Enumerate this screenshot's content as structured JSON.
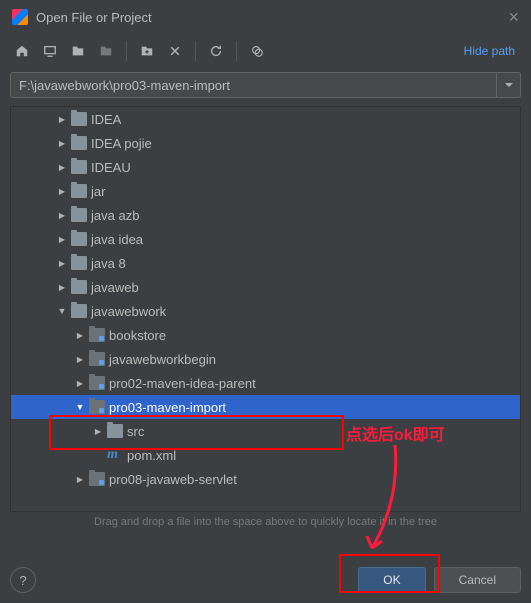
{
  "window": {
    "title": "Open File or Project",
    "hide_path": "Hide path",
    "path": "F:\\javawebwork\\pro03-maven-import",
    "hint": "Drag and drop a file into the space above to quickly locate it in the tree",
    "ok": "OK",
    "cancel": "Cancel"
  },
  "tree": [
    {
      "depth": 2,
      "arrow": "right",
      "icon": "folder",
      "label": "IDEA"
    },
    {
      "depth": 2,
      "arrow": "right",
      "icon": "folder",
      "label": "IDEA pojie"
    },
    {
      "depth": 2,
      "arrow": "right",
      "icon": "folder",
      "label": "IDEAU"
    },
    {
      "depth": 2,
      "arrow": "right",
      "icon": "folder",
      "label": "jar"
    },
    {
      "depth": 2,
      "arrow": "right",
      "icon": "folder",
      "label": "java azb"
    },
    {
      "depth": 2,
      "arrow": "right",
      "icon": "folder",
      "label": "java idea"
    },
    {
      "depth": 2,
      "arrow": "right",
      "icon": "folder",
      "label": "java 8"
    },
    {
      "depth": 2,
      "arrow": "right",
      "icon": "folder",
      "label": "javaweb"
    },
    {
      "depth": 2,
      "arrow": "down",
      "icon": "folder",
      "label": "javawebwork"
    },
    {
      "depth": 3,
      "arrow": "right",
      "icon": "mfolder",
      "label": "bookstore"
    },
    {
      "depth": 3,
      "arrow": "right",
      "icon": "mfolder",
      "label": "javawebworkbegin"
    },
    {
      "depth": 3,
      "arrow": "right",
      "icon": "mfolder",
      "label": "pro02-maven-idea-parent"
    },
    {
      "depth": 3,
      "arrow": "down",
      "icon": "mfolder",
      "label": "pro03-maven-import",
      "selected": true
    },
    {
      "depth": 4,
      "arrow": "right",
      "icon": "folder",
      "label": "src"
    },
    {
      "depth": 4,
      "arrow": "none",
      "icon": "m",
      "label": "pom.xml"
    },
    {
      "depth": 3,
      "arrow": "right",
      "icon": "mfolder",
      "label": "pro08-javaweb-servlet"
    }
  ],
  "annotation": {
    "text": "点选后ok即可"
  }
}
